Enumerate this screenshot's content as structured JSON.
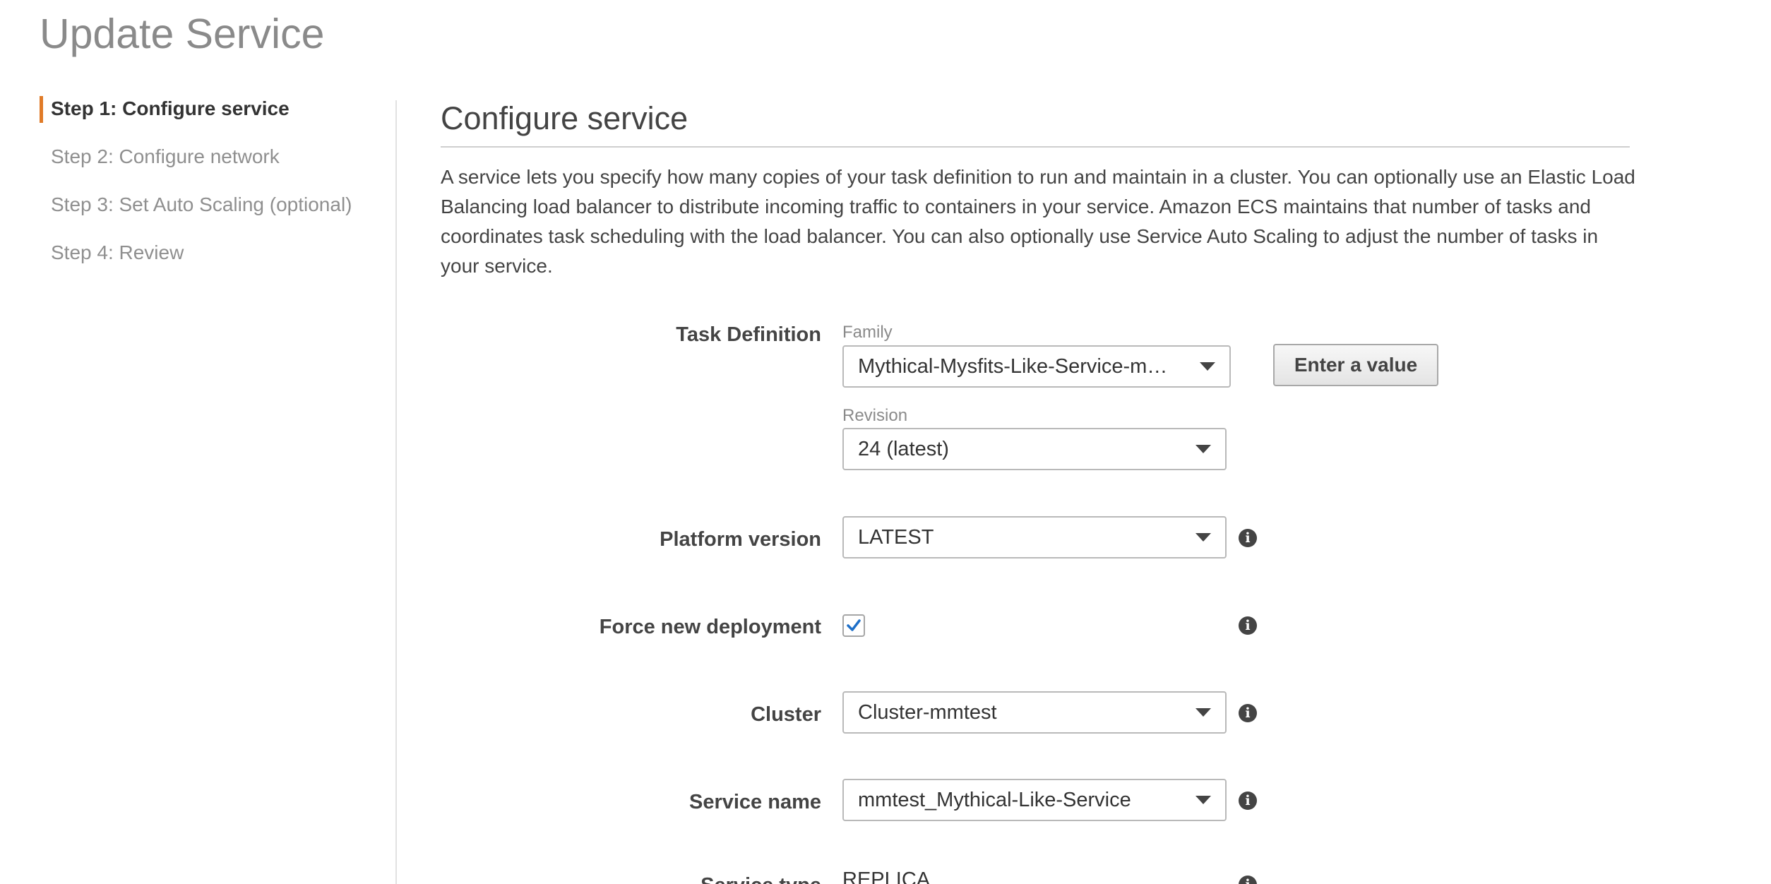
{
  "page": {
    "title": "Update Service"
  },
  "steps": [
    {
      "label": "Step 1: Configure service",
      "active": true
    },
    {
      "label": "Step 2: Configure network",
      "active": false
    },
    {
      "label": "Step 3: Set Auto Scaling (optional)",
      "active": false
    },
    {
      "label": "Step 4: Review",
      "active": false
    }
  ],
  "section": {
    "title": "Configure service",
    "description": "A service lets you specify how many copies of your task definition to run and maintain in a cluster. You can optionally use an Elastic Load Balancing load balancer to distribute incoming traffic to containers in your service. Amazon ECS maintains that number of tasks and coordinates task scheduling with the load balancer. You can also optionally use Service Auto Scaling to adjust the number of tasks in your service."
  },
  "form": {
    "task_definition": {
      "label": "Task Definition",
      "family_label": "Family",
      "family_value": "Mythical-Mysfits-Like-Service-mmtest",
      "revision_label": "Revision",
      "revision_value": "24 (latest)",
      "enter_value_button": "Enter a value"
    },
    "platform_version": {
      "label": "Platform version",
      "value": "LATEST"
    },
    "force_new_deployment": {
      "label": "Force new deployment",
      "checked": true
    },
    "cluster": {
      "label": "Cluster",
      "value": "Cluster-mmtest"
    },
    "service_name": {
      "label": "Service name",
      "value": "mmtest_Mythical-Like-Service"
    },
    "service_type": {
      "label": "Service type",
      "value": "REPLICA"
    }
  },
  "colors": {
    "active_step_accent": "#e07b28",
    "checkbox_check": "#1e6fc8",
    "muted_text": "#8f8f8f"
  },
  "icons": {
    "dropdown": "caret-down-icon",
    "info": "info-icon",
    "check": "checkmark-icon"
  }
}
